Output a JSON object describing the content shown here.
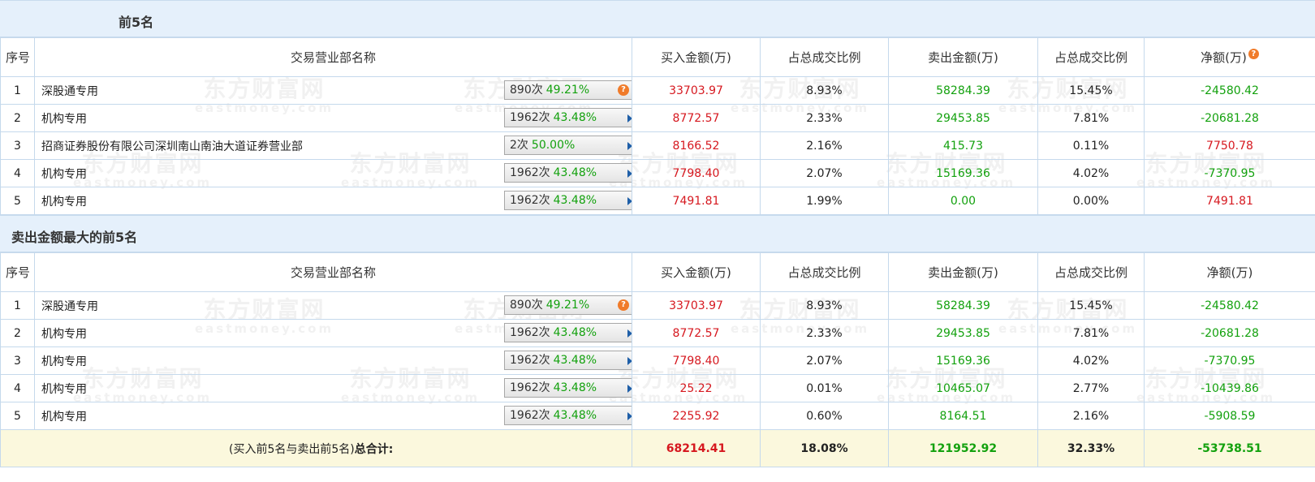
{
  "buy_section": {
    "title": "前5名",
    "headers": [
      "序号",
      "交易营业部名称",
      "买入金额(万)",
      "占总成交比例",
      "卖出金额(万)",
      "占总成交比例",
      "净额(万)"
    ],
    "rows": [
      {
        "idx": "1",
        "name": "深股通专用",
        "count": "890次",
        "pct": "49.21%",
        "icon": "help-icon",
        "buy": "33703.97",
        "buy_ratio": "8.93%",
        "sell": "58284.39",
        "sell_ratio": "15.45%",
        "net": "-24580.42"
      },
      {
        "idx": "2",
        "name": "机构专用",
        "count": "1962次",
        "pct": "43.48%",
        "icon": "arrow-right-icon",
        "buy": "8772.57",
        "buy_ratio": "2.33%",
        "sell": "29453.85",
        "sell_ratio": "7.81%",
        "net": "-20681.28"
      },
      {
        "idx": "3",
        "name": "招商证券股份有限公司深圳南山南油大道证券营业部",
        "count": "2次",
        "pct": "50.00%",
        "icon": "arrow-right-icon",
        "buy": "8166.52",
        "buy_ratio": "2.16%",
        "sell": "415.73",
        "sell_ratio": "0.11%",
        "net": "7750.78"
      },
      {
        "idx": "4",
        "name": "机构专用",
        "count": "1962次",
        "pct": "43.48%",
        "icon": "arrow-right-icon",
        "buy": "7798.40",
        "buy_ratio": "2.07%",
        "sell": "15169.36",
        "sell_ratio": "4.02%",
        "net": "-7370.95"
      },
      {
        "idx": "5",
        "name": "机构专用",
        "count": "1962次",
        "pct": "43.48%",
        "icon": "arrow-right-icon",
        "buy": "7491.81",
        "buy_ratio": "1.99%",
        "sell": "0.00",
        "sell_ratio": "0.00%",
        "net": "7491.81"
      }
    ]
  },
  "sell_section": {
    "title": "卖出金额最大的前5名",
    "headers": [
      "序号",
      "交易营业部名称",
      "买入金额(万)",
      "占总成交比例",
      "卖出金额(万)",
      "占总成交比例",
      "净额(万)"
    ],
    "rows": [
      {
        "idx": "1",
        "name": "深股通专用",
        "count": "890次",
        "pct": "49.21%",
        "icon": "help-icon",
        "buy": "33703.97",
        "buy_ratio": "8.93%",
        "sell": "58284.39",
        "sell_ratio": "15.45%",
        "net": "-24580.42"
      },
      {
        "idx": "2",
        "name": "机构专用",
        "count": "1962次",
        "pct": "43.48%",
        "icon": "arrow-right-icon",
        "buy": "8772.57",
        "buy_ratio": "2.33%",
        "sell": "29453.85",
        "sell_ratio": "7.81%",
        "net": "-20681.28"
      },
      {
        "idx": "3",
        "name": "机构专用",
        "count": "1962次",
        "pct": "43.48%",
        "icon": "arrow-right-icon",
        "buy": "7798.40",
        "buy_ratio": "2.07%",
        "sell": "15169.36",
        "sell_ratio": "4.02%",
        "net": "-7370.95"
      },
      {
        "idx": "4",
        "name": "机构专用",
        "count": "1962次",
        "pct": "43.48%",
        "icon": "arrow-right-icon",
        "buy": "25.22",
        "buy_ratio": "0.01%",
        "sell": "10465.07",
        "sell_ratio": "2.77%",
        "net": "-10439.86"
      },
      {
        "idx": "5",
        "name": "机构专用",
        "count": "1962次",
        "pct": "43.48%",
        "icon": "arrow-right-icon",
        "buy": "2255.92",
        "buy_ratio": "0.60%",
        "sell": "8164.51",
        "sell_ratio": "2.16%",
        "net": "-5908.59"
      }
    ]
  },
  "total": {
    "label_prefix": "(买入前5名与卖出前5名)",
    "label_bold": "总合计:",
    "buy": "68214.41",
    "buy_ratio": "18.08%",
    "sell": "121952.92",
    "sell_ratio": "32.33%",
    "net": "-53738.51"
  },
  "help_glyph": "?",
  "watermark": {
    "brand": "东方财富网",
    "domain": "eastmoney.com"
  },
  "colors": {
    "red": "#d6181f",
    "green": "#13a10e",
    "header_bg": "#e5f0fb",
    "total_bg": "#fbf8dd",
    "help_orange": "#f07b2a"
  }
}
